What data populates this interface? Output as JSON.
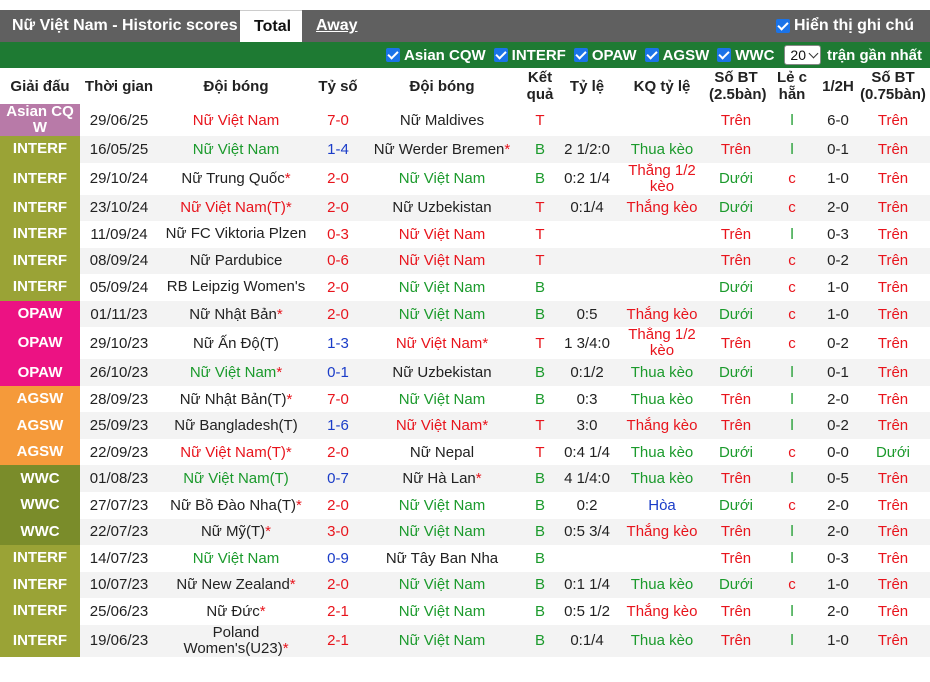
{
  "header": {
    "title": "Nữ Việt Nam - Historic scores",
    "tab_total": "Total",
    "tab_away": "Away",
    "show_cn_label": "Hiển thị ghi chú"
  },
  "filters": {
    "items": [
      "Asian CQW",
      "INTERF",
      "OPAW",
      "AGSW",
      "WWC"
    ],
    "count_value": "20",
    "recent_label": "trận gần nhất"
  },
  "columns": [
    "Giải đấu",
    "Thời gian",
    "Đội bóng",
    "Tỷ số",
    "Đội bóng",
    "Kết quả",
    "Tỷ lệ",
    "KQ tỷ lệ",
    "Số BT (2.5bàn)",
    "Lẻ c hẵn",
    "1/2H",
    "Số BT (0.75bàn)"
  ],
  "colors": {
    "Asian CQW": "#b87aa8",
    "INTERF": "#9aa336",
    "OPAW": "#ec1283",
    "AGSW": "#f59a3a",
    "WWC": "#7a8c2a",
    "win_green": "#1b9a2c",
    "loss_red": "#e8141c",
    "draw_blue": "#1a3cc8",
    "filter_bar": "#1e7a33"
  },
  "rows": [
    {
      "comp": "Asian CQ W",
      "comp_key": "Asian CQW",
      "date": "29/06/25",
      "home": "Nữ Việt Nam",
      "home_color": "red",
      "home_star": "",
      "score": "7-0",
      "score_color": "red",
      "away": "Nữ Maldives",
      "away_color": "dark",
      "away_star": "",
      "result": "T",
      "result_color": "red",
      "odds": "",
      "odds_result": "",
      "odds_result_color": "dark",
      "ou": "Trên",
      "ou_color": "red",
      "oe": "l",
      "oe_color": "green",
      "half": "6-0",
      "ou2": "Trên",
      "ou2_color": "red"
    },
    {
      "comp": "INTERF",
      "comp_key": "INTERF",
      "date": "16/05/25",
      "home": "Nữ Việt Nam",
      "home_color": "green",
      "home_star": "",
      "score": "1-4",
      "score_color": "blue",
      "away": "Nữ Werder Bremen",
      "away_color": "dark",
      "away_star": "*",
      "result": "B",
      "result_color": "green",
      "odds": "2 1/2:0",
      "odds_result": "Thua kèo",
      "odds_result_color": "green",
      "ou": "Trên",
      "ou_color": "red",
      "oe": "l",
      "oe_color": "green",
      "half": "0-1",
      "ou2": "Trên",
      "ou2_color": "red"
    },
    {
      "comp": "INTERF",
      "comp_key": "INTERF",
      "date": "29/10/24",
      "home": "Nữ Trung Quốc",
      "home_color": "dark",
      "home_star": "*",
      "score": "2-0",
      "score_color": "red",
      "away": "Nữ Việt Nam",
      "away_color": "green",
      "away_star": "",
      "result": "B",
      "result_color": "green",
      "odds": "0:2 1/4",
      "odds_result": "Thắng 1/2 kèo",
      "odds_result_color": "red",
      "ou": "Dưới",
      "ou_color": "green",
      "oe": "c",
      "oe_color": "red",
      "half": "1-0",
      "ou2": "Trên",
      "ou2_color": "red"
    },
    {
      "comp": "INTERF",
      "comp_key": "INTERF",
      "date": "23/10/24",
      "home": "Nữ Việt Nam(T)",
      "home_color": "red",
      "home_star": "*",
      "score": "2-0",
      "score_color": "red",
      "away": "Nữ Uzbekistan",
      "away_color": "dark",
      "away_star": "",
      "result": "T",
      "result_color": "red",
      "odds": "0:1/4",
      "odds_result": "Thắng kèo",
      "odds_result_color": "red",
      "ou": "Dưới",
      "ou_color": "green",
      "oe": "c",
      "oe_color": "red",
      "half": "2-0",
      "ou2": "Trên",
      "ou2_color": "red"
    },
    {
      "comp": "INTERF",
      "comp_key": "INTERF",
      "date": "11/09/24",
      "home": "Nữ FC Viktoria Plzen",
      "home_color": "dark",
      "home_star": "",
      "score": "0-3",
      "score_color": "red",
      "away": "Nữ Việt Nam",
      "away_color": "red",
      "away_star": "",
      "result": "T",
      "result_color": "red",
      "odds": "",
      "odds_result": "",
      "odds_result_color": "dark",
      "ou": "Trên",
      "ou_color": "red",
      "oe": "l",
      "oe_color": "green",
      "half": "0-3",
      "ou2": "Trên",
      "ou2_color": "red"
    },
    {
      "comp": "INTERF",
      "comp_key": "INTERF",
      "date": "08/09/24",
      "home": "Nữ Pardubice",
      "home_color": "dark",
      "home_star": "",
      "score": "0-6",
      "score_color": "red",
      "away": "Nữ Việt Nam",
      "away_color": "red",
      "away_star": "",
      "result": "T",
      "result_color": "red",
      "odds": "",
      "odds_result": "",
      "odds_result_color": "dark",
      "ou": "Trên",
      "ou_color": "red",
      "oe": "c",
      "oe_color": "red",
      "half": "0-2",
      "ou2": "Trên",
      "ou2_color": "red"
    },
    {
      "comp": "INTERF",
      "comp_key": "INTERF",
      "date": "05/09/24",
      "home": "RB Leipzig Women's",
      "home_color": "dark",
      "home_star": "",
      "score": "2-0",
      "score_color": "red",
      "away": "Nữ Việt Nam",
      "away_color": "green",
      "away_star": "",
      "result": "B",
      "result_color": "green",
      "odds": "",
      "odds_result": "",
      "odds_result_color": "dark",
      "ou": "Dưới",
      "ou_color": "green",
      "oe": "c",
      "oe_color": "red",
      "half": "1-0",
      "ou2": "Trên",
      "ou2_color": "red"
    },
    {
      "comp": "OPAW",
      "comp_key": "OPAW",
      "date": "01/11/23",
      "home": "Nữ Nhật Bản",
      "home_color": "dark",
      "home_star": "*",
      "score": "2-0",
      "score_color": "red",
      "away": "Nữ Việt Nam",
      "away_color": "green",
      "away_star": "",
      "result": "B",
      "result_color": "green",
      "odds": "0:5",
      "odds_result": "Thắng kèo",
      "odds_result_color": "red",
      "ou": "Dưới",
      "ou_color": "green",
      "oe": "c",
      "oe_color": "red",
      "half": "1-0",
      "ou2": "Trên",
      "ou2_color": "red"
    },
    {
      "comp": "OPAW",
      "comp_key": "OPAW",
      "date": "29/10/23",
      "home": "Nữ Ấn Độ(T)",
      "home_color": "dark",
      "home_star": "",
      "score": "1-3",
      "score_color": "blue",
      "away": "Nữ Việt Nam",
      "away_color": "red",
      "away_star": "*",
      "result": "T",
      "result_color": "red",
      "odds": "1 3/4:0",
      "odds_result": "Thắng 1/2 kèo",
      "odds_result_color": "red",
      "ou": "Trên",
      "ou_color": "red",
      "oe": "c",
      "oe_color": "red",
      "half": "0-2",
      "ou2": "Trên",
      "ou2_color": "red"
    },
    {
      "comp": "OPAW",
      "comp_key": "OPAW",
      "date": "26/10/23",
      "home": "Nữ Việt Nam",
      "home_color": "green",
      "home_star": "*",
      "score": "0-1",
      "score_color": "blue",
      "away": "Nữ Uzbekistan",
      "away_color": "dark",
      "away_star": "",
      "result": "B",
      "result_color": "green",
      "odds": "0:1/2",
      "odds_result": "Thua kèo",
      "odds_result_color": "green",
      "ou": "Dưới",
      "ou_color": "green",
      "oe": "l",
      "oe_color": "green",
      "half": "0-1",
      "ou2": "Trên",
      "ou2_color": "red"
    },
    {
      "comp": "AGSW",
      "comp_key": "AGSW",
      "date": "28/09/23",
      "home": "Nữ Nhật Bản(T)",
      "home_color": "dark",
      "home_star": "*",
      "score": "7-0",
      "score_color": "red",
      "away": "Nữ Việt Nam",
      "away_color": "green",
      "away_star": "",
      "result": "B",
      "result_color": "green",
      "odds": "0:3",
      "odds_result": "Thua kèo",
      "odds_result_color": "green",
      "ou": "Trên",
      "ou_color": "red",
      "oe": "l",
      "oe_color": "green",
      "half": "2-0",
      "ou2": "Trên",
      "ou2_color": "red"
    },
    {
      "comp": "AGSW",
      "comp_key": "AGSW",
      "date": "25/09/23",
      "home": "Nữ Bangladesh(T)",
      "home_color": "dark",
      "home_star": "",
      "score": "1-6",
      "score_color": "blue",
      "away": "Nữ Việt Nam",
      "away_color": "red",
      "away_star": "*",
      "result": "T",
      "result_color": "red",
      "odds": "3:0",
      "odds_result": "Thắng kèo",
      "odds_result_color": "red",
      "ou": "Trên",
      "ou_color": "red",
      "oe": "l",
      "oe_color": "green",
      "half": "0-2",
      "ou2": "Trên",
      "ou2_color": "red"
    },
    {
      "comp": "AGSW",
      "comp_key": "AGSW",
      "date": "22/09/23",
      "home": "Nữ Việt Nam(T)",
      "home_color": "red",
      "home_star": "*",
      "score": "2-0",
      "score_color": "red",
      "away": "Nữ Nepal",
      "away_color": "dark",
      "away_star": "",
      "result": "T",
      "result_color": "red",
      "odds": "0:4 1/4",
      "odds_result": "Thua kèo",
      "odds_result_color": "green",
      "ou": "Dưới",
      "ou_color": "green",
      "oe": "c",
      "oe_color": "red",
      "half": "0-0",
      "ou2": "Dưới",
      "ou2_color": "green"
    },
    {
      "comp": "WWC",
      "comp_key": "WWC",
      "date": "01/08/23",
      "home": "Nữ Việt Nam(T)",
      "home_color": "green",
      "home_star": "",
      "score": "0-7",
      "score_color": "blue",
      "away": "Nữ Hà Lan",
      "away_color": "dark",
      "away_star": "*",
      "result": "B",
      "result_color": "green",
      "odds": "4 1/4:0",
      "odds_result": "Thua kèo",
      "odds_result_color": "green",
      "ou": "Trên",
      "ou_color": "red",
      "oe": "l",
      "oe_color": "green",
      "half": "0-5",
      "ou2": "Trên",
      "ou2_color": "red"
    },
    {
      "comp": "WWC",
      "comp_key": "WWC",
      "date": "27/07/23",
      "home": "Nữ Bồ Đào Nha(T)",
      "home_color": "dark",
      "home_star": "*",
      "score": "2-0",
      "score_color": "red",
      "away": "Nữ Việt Nam",
      "away_color": "green",
      "away_star": "",
      "result": "B",
      "result_color": "green",
      "odds": "0:2",
      "odds_result": "Hòa",
      "odds_result_color": "blue",
      "ou": "Dưới",
      "ou_color": "green",
      "oe": "c",
      "oe_color": "red",
      "half": "2-0",
      "ou2": "Trên",
      "ou2_color": "red"
    },
    {
      "comp": "WWC",
      "comp_key": "WWC",
      "date": "22/07/23",
      "home": "Nữ Mỹ(T)",
      "home_color": "dark",
      "home_star": "*",
      "score": "3-0",
      "score_color": "red",
      "away": "Nữ Việt Nam",
      "away_color": "green",
      "away_star": "",
      "result": "B",
      "result_color": "green",
      "odds": "0:5 3/4",
      "odds_result": "Thắng kèo",
      "odds_result_color": "red",
      "ou": "Trên",
      "ou_color": "red",
      "oe": "l",
      "oe_color": "green",
      "half": "2-0",
      "ou2": "Trên",
      "ou2_color": "red"
    },
    {
      "comp": "INTERF",
      "comp_key": "INTERF",
      "date": "14/07/23",
      "home": "Nữ Việt Nam",
      "home_color": "green",
      "home_star": "",
      "score": "0-9",
      "score_color": "blue",
      "away": "Nữ Tây Ban Nha",
      "away_color": "dark",
      "away_star": "",
      "result": "B",
      "result_color": "green",
      "odds": "",
      "odds_result": "",
      "odds_result_color": "dark",
      "ou": "Trên",
      "ou_color": "red",
      "oe": "l",
      "oe_color": "green",
      "half": "0-3",
      "ou2": "Trên",
      "ou2_color": "red"
    },
    {
      "comp": "INTERF",
      "comp_key": "INTERF",
      "date": "10/07/23",
      "home": "Nữ New Zealand",
      "home_color": "dark",
      "home_star": "*",
      "score": "2-0",
      "score_color": "red",
      "away": "Nữ Việt Nam",
      "away_color": "green",
      "away_star": "",
      "result": "B",
      "result_color": "green",
      "odds": "0:1 1/4",
      "odds_result": "Thua kèo",
      "odds_result_color": "green",
      "ou": "Dưới",
      "ou_color": "green",
      "oe": "c",
      "oe_color": "red",
      "half": "1-0",
      "ou2": "Trên",
      "ou2_color": "red"
    },
    {
      "comp": "INTERF",
      "comp_key": "INTERF",
      "date": "25/06/23",
      "home": "Nữ Đức",
      "home_color": "dark",
      "home_star": "*",
      "score": "2-1",
      "score_color": "red",
      "away": "Nữ Việt Nam",
      "away_color": "green",
      "away_star": "",
      "result": "B",
      "result_color": "green",
      "odds": "0:5 1/2",
      "odds_result": "Thắng kèo",
      "odds_result_color": "red",
      "ou": "Trên",
      "ou_color": "red",
      "oe": "l",
      "oe_color": "green",
      "half": "2-0",
      "ou2": "Trên",
      "ou2_color": "red"
    },
    {
      "comp": "INTERF",
      "comp_key": "INTERF",
      "date": "19/06/23",
      "home": "Poland Women's(U23)",
      "home_color": "dark",
      "home_star": "*",
      "score": "2-1",
      "score_color": "red",
      "away": "Nữ Việt Nam",
      "away_color": "green",
      "away_star": "",
      "result": "B",
      "result_color": "green",
      "odds": "0:1/4",
      "odds_result": "Thua kèo",
      "odds_result_color": "green",
      "ou": "Trên",
      "ou_color": "red",
      "oe": "l",
      "oe_color": "green",
      "half": "1-0",
      "ou2": "Trên",
      "ou2_color": "red"
    }
  ]
}
